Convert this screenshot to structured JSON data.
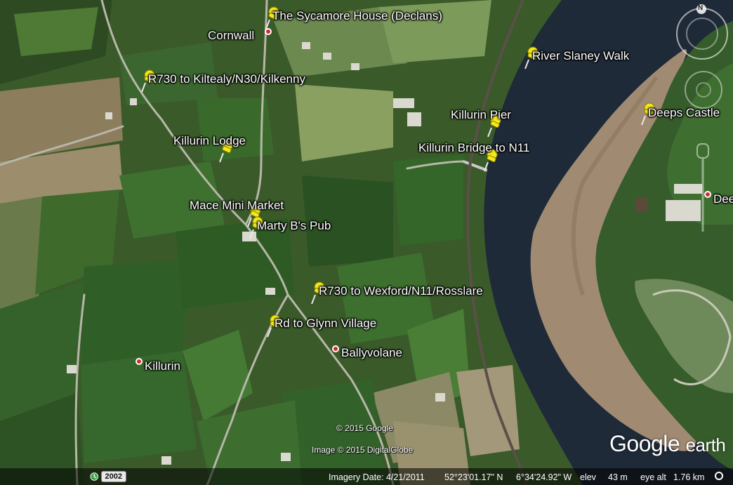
{
  "map": {
    "placemarks": [
      {
        "id": "sycamore-house",
        "label": "The Sycamore House (Declans)",
        "type": "pin"
      },
      {
        "id": "cornwall",
        "label": "Cornwall",
        "type": "dot"
      },
      {
        "id": "river-slaney-walk",
        "label": "River Slaney Walk",
        "type": "pin"
      },
      {
        "id": "r730-kiltealy",
        "label": "R730 to Kiltealy/N30/Kilkenny",
        "type": "pin"
      },
      {
        "id": "deeps-castle",
        "label": "Deeps Castle",
        "type": "pin"
      },
      {
        "id": "killurin-pier",
        "label": "Killurin Pier",
        "type": "pin"
      },
      {
        "id": "killurin-lodge",
        "label": "Killurin Lodge",
        "type": "pin"
      },
      {
        "id": "killurin-bridge",
        "label": "Killurin Bridge to N11",
        "type": "pin"
      },
      {
        "id": "deeps",
        "label": "Dee",
        "type": "dot"
      },
      {
        "id": "mace-mini-market",
        "label": "Mace Mini Market",
        "type": "pin"
      },
      {
        "id": "marty-bs-pub",
        "label": "Marty B's Pub",
        "type": "pin"
      },
      {
        "id": "r730-wexford",
        "label": "R730 to Wexford/N11/Rosslare",
        "type": "pin"
      },
      {
        "id": "rd-glynn",
        "label": "Rd to Glynn Village",
        "type": "pin"
      },
      {
        "id": "ballyvolane",
        "label": "Ballyvolane",
        "type": "dot"
      },
      {
        "id": "killurin",
        "label": "Killurin",
        "type": "dot"
      }
    ],
    "credits": {
      "google": "© 2015 Google",
      "imagery": "Image © 2015 DigitalGlobe"
    },
    "compass": {
      "north_label": "N"
    }
  },
  "statusbar": {
    "history_year": "2002",
    "imagery_date": "Imagery Date: 4/21/2011",
    "latitude": "52°23'01.17\" N",
    "longitude": "6°34'24.92\" W",
    "elev_label": "elev",
    "elev_value": "43 m",
    "eye_alt_label": "eye alt",
    "eye_alt_value": "1.76 km"
  },
  "branding": {
    "google": "Google",
    "earth": "earth"
  },
  "colors": {
    "pin_yellow": "#f2e81a",
    "dot_red": "#d32b2b",
    "river": "#1f2a38",
    "reeds": "#a08a72",
    "field_dark": "#2f4d22",
    "field_light": "#5a7d3a"
  }
}
